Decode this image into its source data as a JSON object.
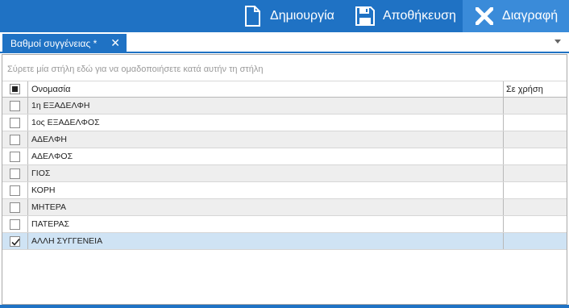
{
  "toolbar": {
    "new_label": "Δημιουργία",
    "save_label": "Αποθήκευση",
    "delete_label": "Διαγραφή",
    "bg_color": "#1f72c4"
  },
  "tab": {
    "title": "Βαθμοί συγγένειας *",
    "close_glyph": "✕"
  },
  "grid": {
    "group_panel_hint": "Σύρετε μία στήλη εδώ για να ομαδοποιήσετε κατά αυτήν τη στήλη",
    "columns": {
      "name": "Ονομασία",
      "in_use": "Σε χρήση"
    },
    "rows": [
      {
        "name": "1η ΕΞΑΔΕΛΦΗ",
        "checked": false
      },
      {
        "name": "1ος ΕΞΑΔΕΛΦΟΣ",
        "checked": false
      },
      {
        "name": "ΑΔΕΛΦΗ",
        "checked": false
      },
      {
        "name": "ΑΔΕΛΦΟΣ",
        "checked": false
      },
      {
        "name": "ΓΙΟΣ",
        "checked": false
      },
      {
        "name": "ΚΟΡΗ",
        "checked": false
      },
      {
        "name": "ΜΗΤΕΡΑ",
        "checked": false
      },
      {
        "name": "ΠΑΤΕΡΑΣ",
        "checked": false
      },
      {
        "name": "ΑΛΛΗ ΣΥΓΓΕΝΕΙΑ",
        "checked": true
      }
    ]
  }
}
